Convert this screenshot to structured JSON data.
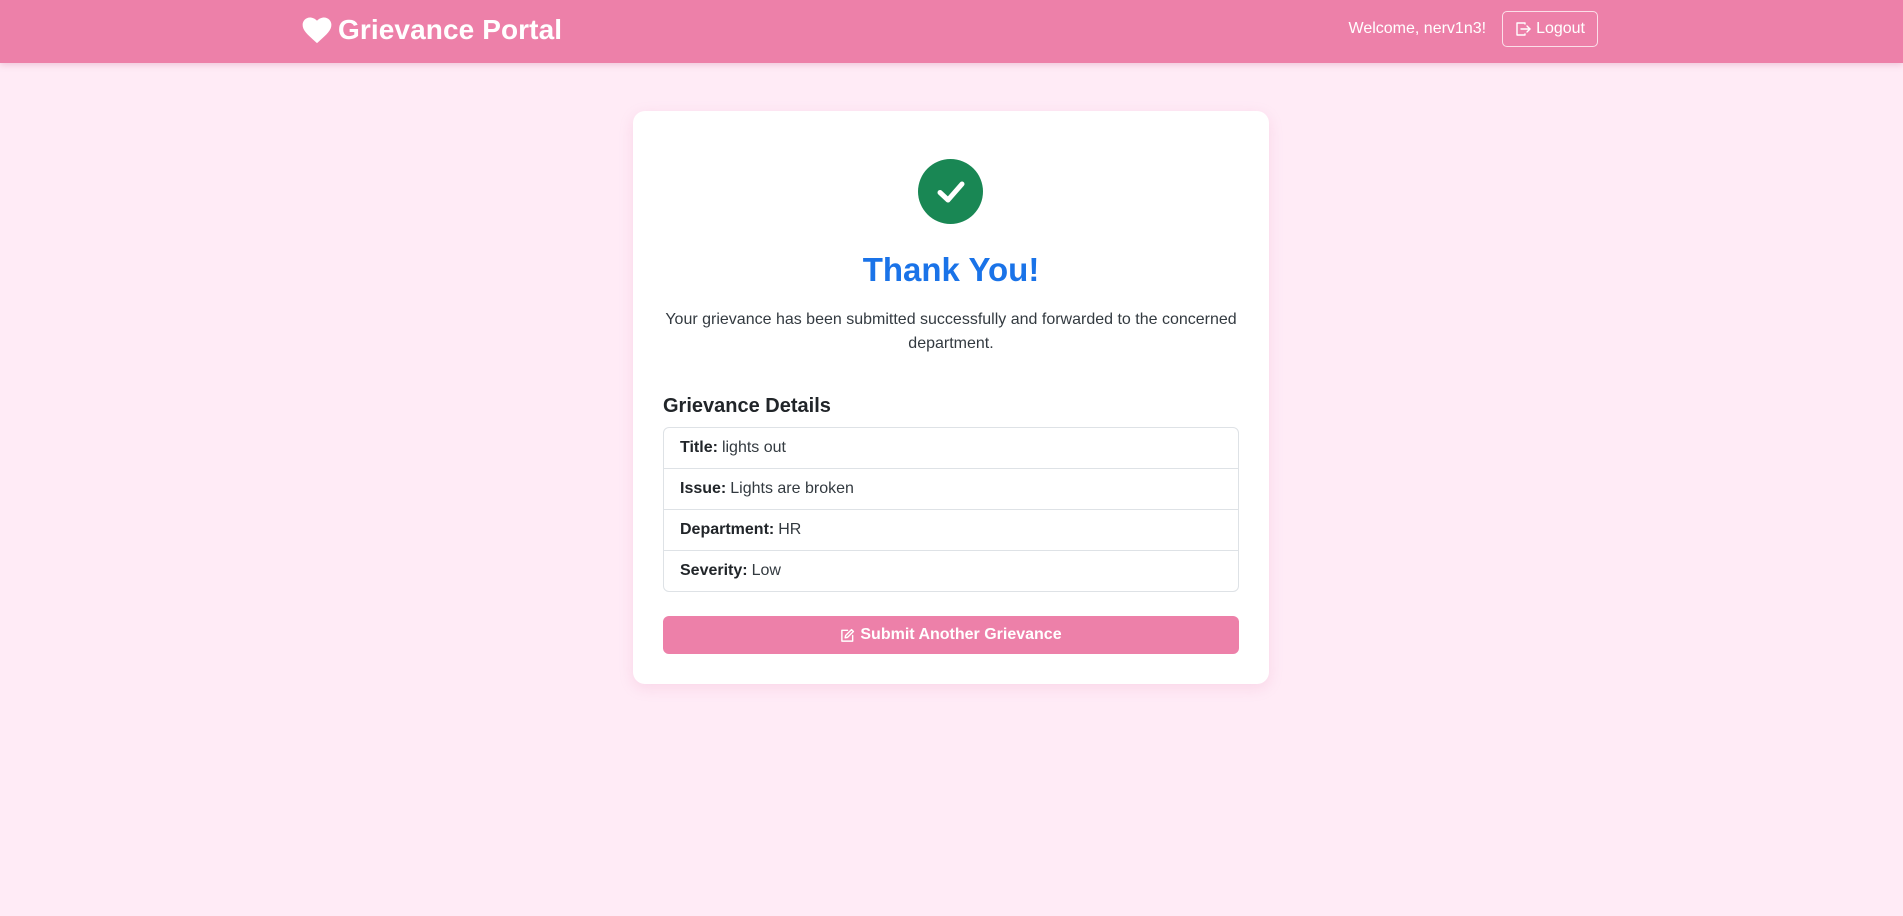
{
  "navbar": {
    "brand": "Grievance Portal",
    "brand_icon": "heart-icon",
    "welcome": "Welcome, nerv1n3!",
    "logout_label": "Logout",
    "logout_icon": "logout-icon"
  },
  "confirmation": {
    "status_icon": "check-circle-icon",
    "title": "Thank You!",
    "message": "Your grievance has been submitted successfully and forwarded to the concerned department."
  },
  "details": {
    "heading": "Grievance Details",
    "items": [
      {
        "label": "Title:",
        "value": "lights out"
      },
      {
        "label": "Issue:",
        "value": "Lights are broken"
      },
      {
        "label": "Department:",
        "value": "HR"
      },
      {
        "label": "Severity:",
        "value": "Low"
      }
    ]
  },
  "actions": {
    "submit_another_label": "Submit Another Grievance",
    "submit_another_icon": "edit-icon"
  },
  "colors": {
    "navbar_bg": "#ed80a9",
    "page_bg": "#ffebf6",
    "success": "#198754",
    "title": "#1a73e8"
  }
}
